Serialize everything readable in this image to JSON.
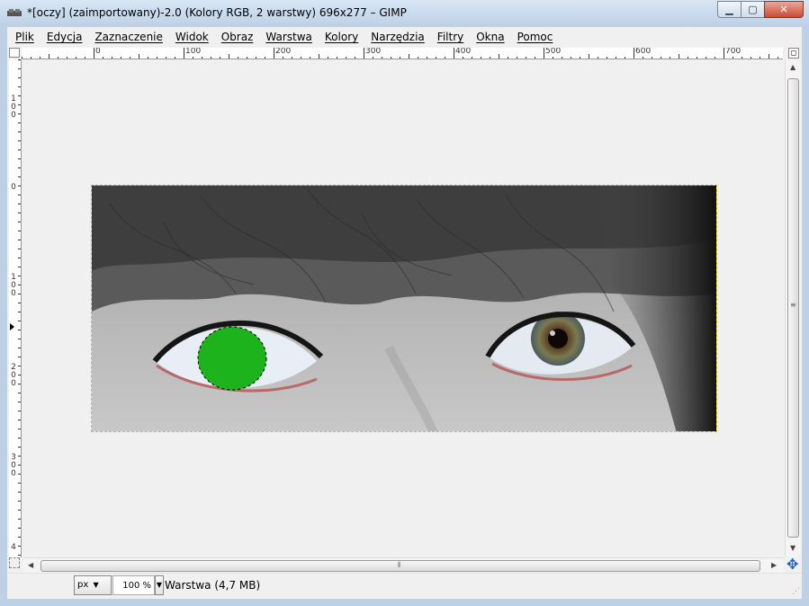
{
  "window": {
    "title": "*[oczy] (zaimportowany)-2.0 (Kolory RGB, 2 warstwy) 696x277 – GIMP",
    "buttons": {
      "minimize": "▁",
      "maximize": "▢",
      "close": "✕"
    }
  },
  "menu": [
    {
      "label": "Plik"
    },
    {
      "label": "Edycja"
    },
    {
      "label": "Zaznaczenie"
    },
    {
      "label": "Widok"
    },
    {
      "label": "Obraz"
    },
    {
      "label": "Warstwa"
    },
    {
      "label": "Kolory"
    },
    {
      "label": "Narzędzia"
    },
    {
      "label": "Filtry"
    },
    {
      "label": "Okna"
    },
    {
      "label": "Pomoc"
    }
  ],
  "ruler": {
    "horizontal_labels": [
      "0",
      "100",
      "200",
      "300",
      "400",
      "500",
      "600",
      "700"
    ],
    "vertical_labels": [
      "100",
      "0",
      "100",
      "200",
      "300",
      "4"
    ]
  },
  "statusbar": {
    "unit": "px",
    "zoom": "100 %",
    "layer_info": "Warstwa (4,7 MB)"
  },
  "image": {
    "description_colors": {
      "selection_fill": "#1db31d",
      "marching_ants": "#d8c400"
    }
  },
  "icons": [
    "app-icon",
    "navigate-icon",
    "quick-mask-icon",
    "zoom-dropdown-icon"
  ]
}
